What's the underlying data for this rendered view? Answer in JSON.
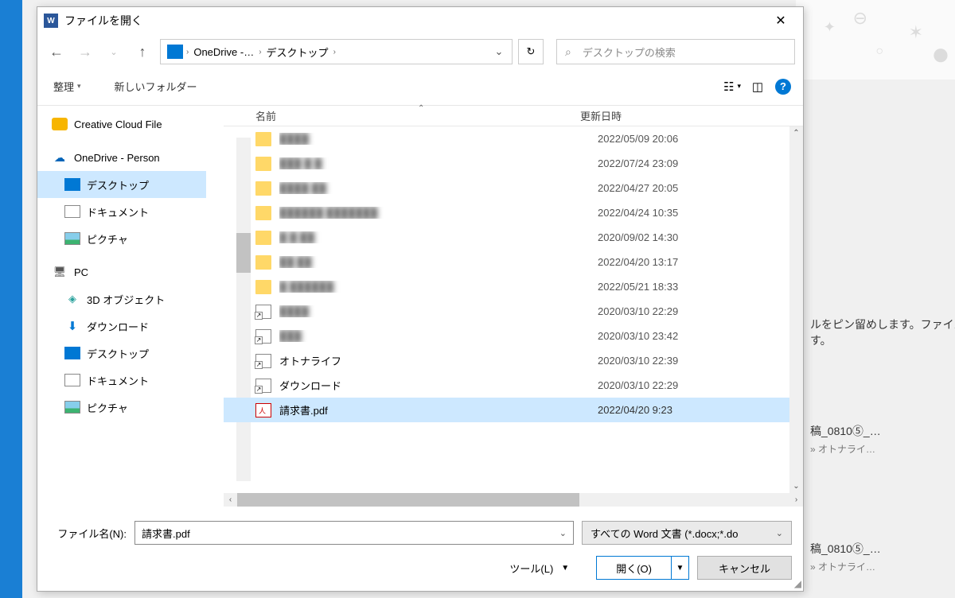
{
  "window": {
    "title": "ファイルを開く"
  },
  "path": {
    "seg1": "OneDrive -…",
    "seg2": "デスクトップ"
  },
  "search": {
    "placeholder": "デスクトップの検索"
  },
  "toolbar": {
    "organize": "整理",
    "newfolder": "新しいフォルダー"
  },
  "tree": {
    "items": [
      {
        "label": "Creative Cloud File"
      },
      {
        "label": "OneDrive - Person"
      },
      {
        "label": "デスクトップ"
      },
      {
        "label": "ドキュメント"
      },
      {
        "label": "ピクチャ"
      },
      {
        "label": "PC"
      },
      {
        "label": "3D オブジェクト"
      },
      {
        "label": "ダウンロード"
      },
      {
        "label": "デスクトップ"
      },
      {
        "label": "ドキュメント"
      },
      {
        "label": "ピクチャ"
      }
    ]
  },
  "columns": {
    "name": "名前",
    "modified": "更新日時"
  },
  "files": [
    {
      "name": "████",
      "date": "2022/05/09 20:06",
      "icon": "folder",
      "blur": true
    },
    {
      "name": "███ █ █",
      "date": "2022/07/24 23:09",
      "icon": "folder",
      "blur": true
    },
    {
      "name": "████ ██",
      "date": "2022/04/27 20:05",
      "icon": "folder",
      "blur": true
    },
    {
      "name": "██████ ███████",
      "date": "2022/04/24 10:35",
      "icon": "folder",
      "blur": true
    },
    {
      "name": "█ █ ██",
      "date": "2020/09/02 14:30",
      "icon": "folder",
      "blur": true
    },
    {
      "name": "██ ██",
      "date": "2022/04/20 13:17",
      "icon": "folder",
      "blur": true
    },
    {
      "name": "█ ██████",
      "date": "2022/05/21 18:33",
      "icon": "folder",
      "blur": true
    },
    {
      "name": "████",
      "date": "2020/03/10 22:29",
      "icon": "shortcut",
      "blur": true
    },
    {
      "name": "███",
      "date": "2020/03/10 23:42",
      "icon": "shortcut",
      "blur": true
    },
    {
      "name": "オトナライフ",
      "date": "2020/03/10 22:39",
      "icon": "shortcut",
      "blur": false
    },
    {
      "name": "ダウンロード",
      "date": "2020/03/10 22:29",
      "icon": "shortcut",
      "blur": false
    },
    {
      "name": "請求書.pdf",
      "date": "2022/04/20 9:23",
      "icon": "pdf",
      "blur": false,
      "selected": true
    }
  ],
  "form": {
    "filename_label": "ファイル名(N):",
    "filename_value": "請求書.pdf",
    "filter": "すべての Word 文書 (*.docx;*.do",
    "tools": "ツール(L)",
    "open": "開く(O)",
    "cancel": "キャンセル"
  },
  "background": {
    "hint1": "ルをピン留めします。ファイル",
    "hint2": "す。",
    "recent1": "稿_0810⑤_…",
    "recent1b": "» オトナライ…",
    "recent2": "稿_0810⑤_…",
    "recent2b": "» オトナライ…"
  }
}
